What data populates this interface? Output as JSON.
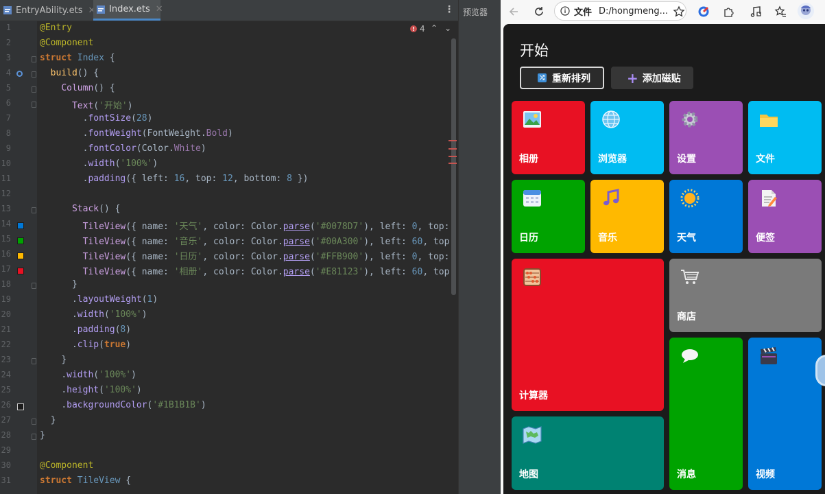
{
  "ide": {
    "tabs": [
      {
        "label": "EntryAbility.ets",
        "active": false
      },
      {
        "label": "Index.ets",
        "active": true
      }
    ],
    "side_panel_label": "预览器",
    "error_count": "4",
    "line_numbers": [
      "1",
      "2",
      "3",
      "4",
      "5",
      "6",
      "7",
      "8",
      "9",
      "10",
      "11",
      "12",
      "13",
      "14",
      "15",
      "16",
      "17",
      "18",
      "19",
      "20",
      "21",
      "22",
      "23",
      "24",
      "25",
      "26",
      "27",
      "28",
      "29",
      "30",
      "31"
    ],
    "code_lines": [
      "@Entry",
      "@Component",
      "struct Index {",
      "  build() {",
      "    Column() {",
      "      Text('开始')",
      "        .fontSize(28)",
      "        .fontWeight(FontWeight.Bold)",
      "        .fontColor(Color.White)",
      "        .width('100%')",
      "        .padding({ left: 16, top: 12, bottom: 8 })",
      "",
      "      Stack() {",
      "        TileView({ name: '天气', color: Color.parse('#0078D7'), left: 0, top:",
      "        TileView({ name: '音乐', color: Color.parse('#00A300'), left: 60, top",
      "        TileView({ name: '日历', color: Color.parse('#FFB900'), left: 0, top:",
      "        TileView({ name: '相册', color: Color.parse('#E81123'), left: 60, top",
      "      }",
      "      .layoutWeight(1)",
      "      .width('100%')",
      "      .padding(8)",
      "      .clip(true)",
      "    }",
      "    .width('100%')",
      "    .height('100%')",
      "    .backgroundColor('#1B1B1B')",
      "  }",
      "}",
      "",
      "@Component",
      "struct TileView {"
    ],
    "gutter_colors": {
      "14": "#0078D7",
      "15": "#00A300",
      "16": "#FFB900",
      "17": "#E81123",
      "26": "#1B1B1B"
    }
  },
  "browser": {
    "address_scheme": "文件",
    "address_url": "D:/hongmeng...",
    "icons": [
      "back-arrow-icon",
      "reload-icon",
      "info-icon",
      "star-icon",
      "extension-icon",
      "puzzle-icon",
      "media-icon",
      "favorites-icon",
      "avatar"
    ]
  },
  "app": {
    "title": "开始",
    "buttons": {
      "rearrange": "重新排列",
      "add_tile": "添加磁贴"
    },
    "tiles": [
      {
        "key": "photos",
        "label": "相册",
        "color": "#E81123",
        "icon": "photo-icon"
      },
      {
        "key": "browser",
        "label": "浏览器",
        "color": "#00BCF2",
        "icon": "globe-icon"
      },
      {
        "key": "settings",
        "label": "设置",
        "color": "#9B4FB4",
        "icon": "gear-icon"
      },
      {
        "key": "files",
        "label": "文件",
        "color": "#00BCF2",
        "icon": "folder-icon"
      },
      {
        "key": "calendar",
        "label": "日历",
        "color": "#00A300",
        "icon": "calendar-icon"
      },
      {
        "key": "music",
        "label": "音乐",
        "color": "#FFB900",
        "icon": "music-icon"
      },
      {
        "key": "weather",
        "label": "天气",
        "color": "#0078D7",
        "icon": "sun-icon"
      },
      {
        "key": "notes",
        "label": "便签",
        "color": "#9B4FB4",
        "icon": "note-icon"
      },
      {
        "key": "calculator",
        "label": "计算器",
        "color": "#E81123",
        "icon": "abacus-icon"
      },
      {
        "key": "store",
        "label": "商店",
        "color": "#7A7A7A",
        "icon": "cart-icon"
      },
      {
        "key": "messages",
        "label": "消息",
        "color": "#00A300",
        "icon": "chat-icon"
      },
      {
        "key": "video",
        "label": "视频",
        "color": "#0078D7",
        "icon": "clapper-icon"
      },
      {
        "key": "maps",
        "label": "地图",
        "color": "#008272",
        "icon": "map-icon"
      }
    ]
  }
}
